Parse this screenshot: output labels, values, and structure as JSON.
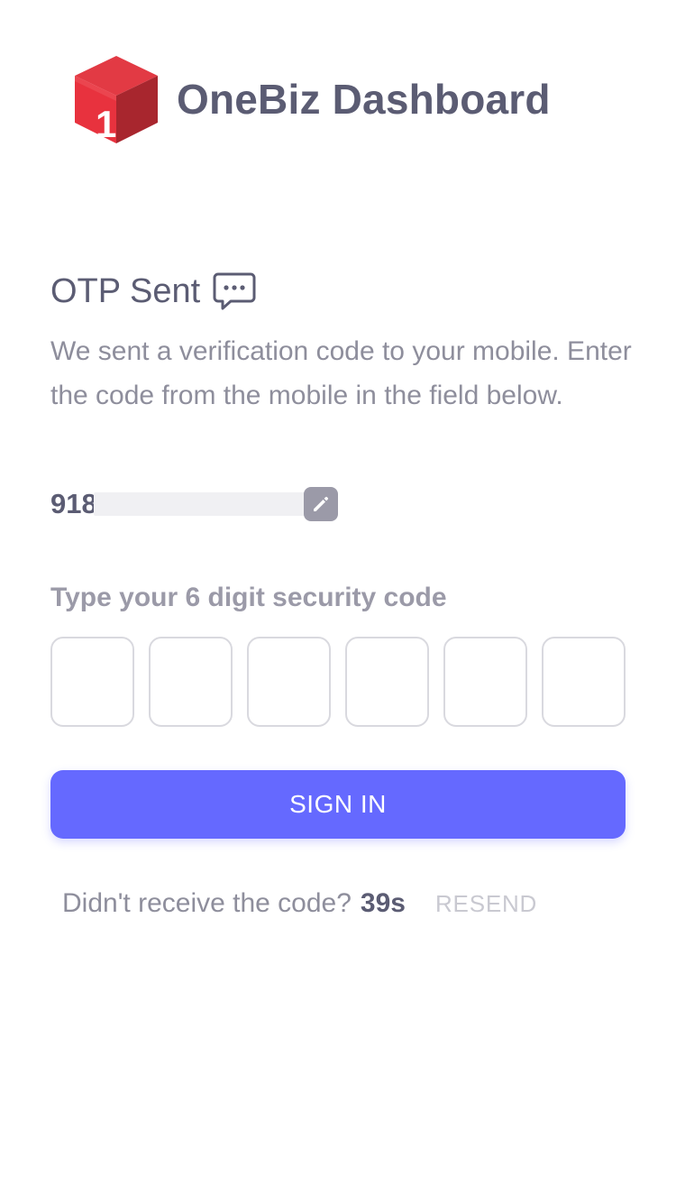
{
  "brand": {
    "logo_icon": "red-cube-logo-icon",
    "logo_digit": "1",
    "name": "OneBiz Dashboard"
  },
  "otp": {
    "heading": "OTP Sent",
    "heading_icon": "chat-bubble-icon",
    "description": "We sent a verification code to your mobile. Enter the code from the mobile in the field below.",
    "phone_visible": "918",
    "edit_icon": "edit-pencil-icon",
    "code_label": "Type your 6 digit security code",
    "digits": [
      "",
      "",
      "",
      "",
      "",
      ""
    ]
  },
  "actions": {
    "sign_in_label": "SIGN IN",
    "resend_prompt": "Didn't receive the code?",
    "timer": "39s",
    "resend_label": "RESEND"
  },
  "colors": {
    "primary": "#6569ff",
    "heading_text": "#5b5c73",
    "muted_text": "#8e8e9c",
    "disabled_text": "#c9c9d1",
    "logo_red": "#e8323e"
  }
}
